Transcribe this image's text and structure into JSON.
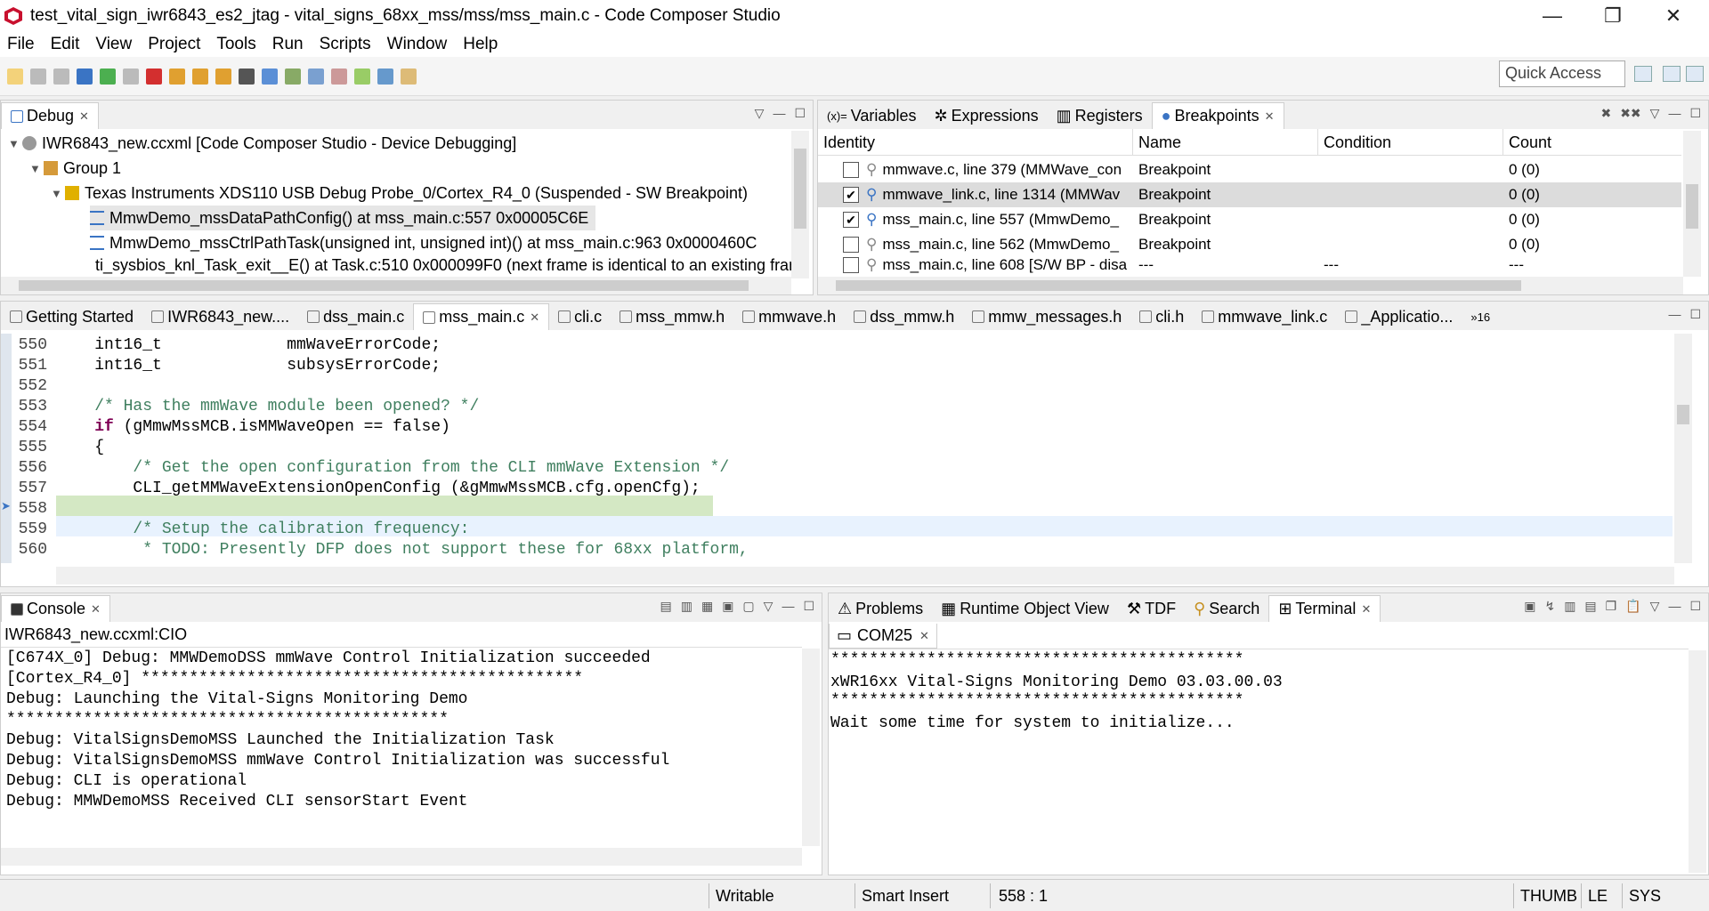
{
  "window": {
    "title": "test_vital_sign_iwr6843_es2_jtag - vital_signs_68xx_mss/mss/mss_main.c - Code Composer Studio",
    "controls": {
      "minimize": "—",
      "restore": "❐",
      "close": "✕"
    }
  },
  "menu": [
    "File",
    "Edit",
    "View",
    "Project",
    "Tools",
    "Run",
    "Scripts",
    "Window",
    "Help"
  ],
  "toolbar": {
    "quick_access": "Quick Access"
  },
  "debug": {
    "tab": "Debug",
    "tree": [
      "IWR6843_new.ccxml [Code Composer Studio - Device Debugging]",
      "Group 1",
      "Texas Instruments XDS110 USB Debug Probe_0/Cortex_R4_0 (Suspended - SW Breakpoint)",
      "MmwDemo_mssDataPathConfig() at mss_main.c:557 0x00005C6E",
      "MmwDemo_mssCtrlPathTask(unsigned int, unsigned int)() at mss_main.c:963 0x0000460C",
      "ti_sysbios_knl_Task_exit__E() at Task.c:510 0x000099F0  (next frame is identical to an existing frame)"
    ]
  },
  "breakpoints_view": {
    "tabs": [
      "Variables",
      "Expressions",
      "Registers",
      "Breakpoints"
    ],
    "headers": [
      "Identity",
      "Name",
      "Condition",
      "Count"
    ],
    "rows": [
      {
        "identity": "mmwave.c, line 379 (MMWave_con",
        "name": "Breakpoint",
        "condition": "",
        "count": "0 (0)",
        "checked": ""
      },
      {
        "identity": "mmwave_link.c, line 1314 (MMWav",
        "name": "Breakpoint",
        "condition": "",
        "count": "0 (0)",
        "checked": "✔"
      },
      {
        "identity": "mss_main.c, line 557 (MmwDemo_",
        "name": "Breakpoint",
        "condition": "",
        "count": "0 (0)",
        "checked": "✔"
      },
      {
        "identity": "mss_main.c, line 562 (MmwDemo_",
        "name": "Breakpoint",
        "condition": "",
        "count": "0 (0)",
        "checked": ""
      },
      {
        "identity": "mss_main.c, line 608 [S/W BP - disa",
        "name": "---",
        "condition": "---",
        "count": "---",
        "checked": ""
      }
    ]
  },
  "editor": {
    "tabs": [
      "Getting Started",
      "IWR6843_new....",
      "dss_main.c",
      "mss_main.c",
      "cli.c",
      "mss_mmw.h",
      "mmwave.h",
      "dss_mmw.h",
      "mmw_messages.h",
      "cli.h",
      "mmwave_link.c",
      "_Applicatio...",
      "»16"
    ],
    "lines": [
      {
        "n": "550",
        "t1": "    int16_t",
        "t2": "             mmWaveErrorCode;"
      },
      {
        "n": "551",
        "t1": "    int16_t",
        "t2": "             subsysErrorCode;"
      },
      {
        "n": "552",
        "t1": "",
        "t2": ""
      },
      {
        "n": "553",
        "t1": "    /* Has the mmWave module been opened? */",
        "t2": ""
      },
      {
        "n": "554",
        "t1": "if",
        "t2": " (gMmwMssMCB.isMMWaveOpen == false)"
      },
      {
        "n": "555",
        "t1": "    {",
        "t2": ""
      },
      {
        "n": "556",
        "t1": "        /* Get the open configuration from the CLI mmWave Extension */",
        "t2": ""
      },
      {
        "n": "557",
        "t1": "CLI_getMMWaveExtensionOpenConfig (&gMmwMssMCB.cfg.openCfg);",
        "t2": ""
      },
      {
        "n": "558",
        "t1": "",
        "t2": ""
      },
      {
        "n": "559",
        "t1": "        /* Setup the calibration frequency:",
        "t2": ""
      },
      {
        "n": "560",
        "t1": "         * TODO",
        "t2": ": Presently DFP does not support these for 68xx platform,"
      }
    ]
  },
  "console": {
    "tab": "Console",
    "subtitle": "IWR6843_new.ccxml:CIO",
    "lines": [
      "[C674X_0] Debug: MMWDemoDSS mmWave Control Initialization succeeded",
      "[Cortex_R4_0] **********************************************",
      "Debug: Launching the Vital-Signs Monitoring Demo",
      "**********************************************",
      "Debug: VitalSignsDemoMSS Launched the Initialization Task",
      "Debug: VitalSignsDemoMSS mmWave Control Initialization was successful",
      "Debug: CLI is operational",
      "Debug: MMWDemoMSS Received CLI sensorStart Event"
    ]
  },
  "terminal": {
    "tabs": [
      "Problems",
      "Runtime Object View",
      "TDF",
      "Search",
      "Terminal"
    ],
    "session": "COM25",
    "lines": [
      "*******************************************",
      "xWR16xx Vital-Signs Monitoring Demo 03.03.00.03",
      "*******************************************",
      "Wait some time for system to initialize..."
    ]
  },
  "status": {
    "writable": "Writable",
    "insert": "Smart Insert",
    "position": "558 : 1",
    "mode": "THUMB",
    "endian": "LE",
    "sys": "SYS"
  }
}
